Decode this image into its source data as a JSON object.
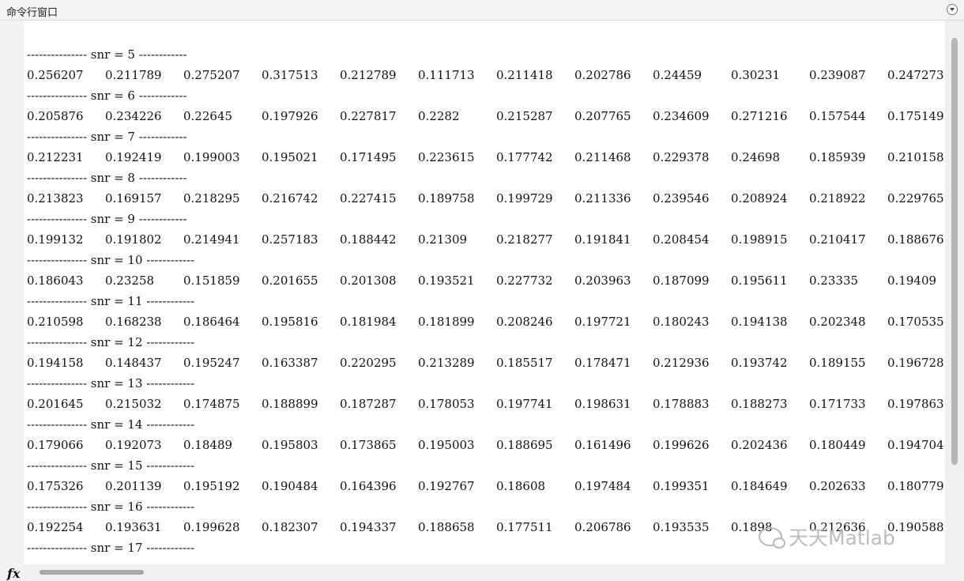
{
  "window": {
    "title": "命令行窗口"
  },
  "watermark": "天天Matlab",
  "output": {
    "blocks": [
      {
        "snr": "--------------- snr = 5 ------------",
        "values": [
          "0.256207",
          "0.211789",
          "0.275207",
          "0.317513",
          "0.212789",
          "0.111713",
          "0.211418",
          "0.202786",
          "0.24459",
          "0.30231",
          "0.239087",
          "0.247273"
        ]
      },
      {
        "snr": "--------------- snr = 6 ------------",
        "values": [
          "0.205876",
          "0.234226",
          "0.22645",
          "0.197926",
          "0.227817",
          "0.2282",
          "0.215287",
          "0.207765",
          "0.234609",
          "0.271216",
          "0.157544",
          "0.175149"
        ]
      },
      {
        "snr": "--------------- snr = 7 ------------",
        "values": [
          "0.212231",
          "0.192419",
          "0.199003",
          "0.195021",
          "0.171495",
          "0.223615",
          "0.177742",
          "0.211468",
          "0.229378",
          "0.24698",
          "0.185939",
          "0.210158"
        ]
      },
      {
        "snr": "--------------- snr = 8 ------------",
        "values": [
          "0.213823",
          "0.169157",
          "0.218295",
          "0.216742",
          "0.227415",
          "0.189758",
          "0.199729",
          "0.211336",
          "0.239546",
          "0.208924",
          "0.218922",
          "0.229765"
        ]
      },
      {
        "snr": "--------------- snr = 9 ------------",
        "values": [
          "0.199132",
          "0.191802",
          "0.214941",
          "0.257183",
          "0.188442",
          "0.21309",
          "0.218277",
          "0.191841",
          "0.208454",
          "0.198915",
          "0.210417",
          "0.188676"
        ]
      },
      {
        "snr": "--------------- snr = 10 ------------",
        "values": [
          "0.186043",
          "0.23258",
          "0.151859",
          "0.201655",
          "0.201308",
          "0.193521",
          "0.227732",
          "0.203963",
          "0.187099",
          "0.195611",
          "0.23335",
          "0.19409"
        ]
      },
      {
        "snr": "--------------- snr = 11 ------------",
        "values": [
          "0.210598",
          "0.168238",
          "0.186464",
          "0.195816",
          "0.181984",
          "0.181899",
          "0.208246",
          "0.197721",
          "0.180243",
          "0.194138",
          "0.202348",
          "0.170535"
        ]
      },
      {
        "snr": "--------------- snr = 12 ------------",
        "values": [
          "0.194158",
          "0.148437",
          "0.195247",
          "0.163387",
          "0.220295",
          "0.213289",
          "0.185517",
          "0.178471",
          "0.212936",
          "0.193742",
          "0.189155",
          "0.196728"
        ]
      },
      {
        "snr": "--------------- snr = 13 ------------",
        "values": [
          "0.201645",
          "0.215032",
          "0.174875",
          "0.188899",
          "0.187287",
          "0.178053",
          "0.197741",
          "0.198631",
          "0.178883",
          "0.188273",
          "0.171733",
          "0.197863"
        ]
      },
      {
        "snr": "--------------- snr = 14 ------------",
        "values": [
          "0.179066",
          "0.192073",
          "0.18489",
          "0.195803",
          "0.173865",
          "0.195003",
          "0.188695",
          "0.161496",
          "0.199626",
          "0.202436",
          "0.180449",
          "0.194704"
        ]
      },
      {
        "snr": "--------------- snr = 15 ------------",
        "values": [
          "0.175326",
          "0.201139",
          "0.195192",
          "0.190484",
          "0.164396",
          "0.192767",
          "0.18608",
          "0.197484",
          "0.199351",
          "0.184649",
          "0.202633",
          "0.180779"
        ]
      },
      {
        "snr": "--------------- snr = 16 ------------",
        "values": [
          "0.192254",
          "0.193631",
          "0.199628",
          "0.182307",
          "0.194337",
          "0.188658",
          "0.177511",
          "0.206786",
          "0.193535",
          "0.1898",
          "0.212636",
          "0.190588"
        ]
      },
      {
        "snr": "--------------- snr = 17 ------------",
        "values": []
      }
    ]
  },
  "icons": {
    "fx": "fx",
    "menu": "chevron-down-icon"
  }
}
